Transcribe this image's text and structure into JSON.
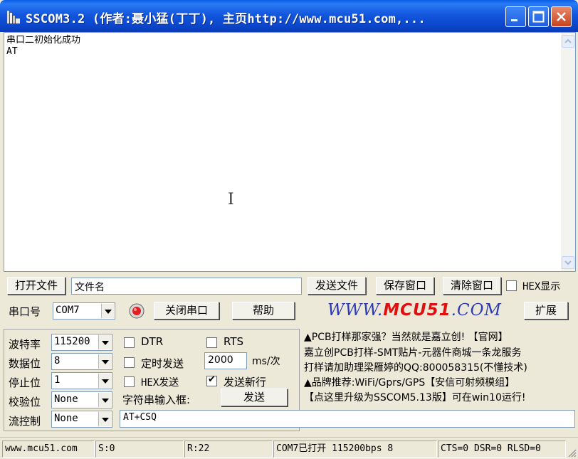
{
  "window": {
    "title": "SSCOM3.2 (作者:聂小猛(丁丁), 主页http://www.mcu51.com,..."
  },
  "receive": {
    "lines": "串口二初始化成功\nAT"
  },
  "file_row": {
    "open_file_label": "打开文件",
    "file_name_value": "文件名",
    "send_file_label": "发送文件",
    "save_window_label": "保存窗口",
    "clear_window_label": "清除窗口",
    "hex_display_label": "HEX显示"
  },
  "port_row": {
    "port_label": "串口号",
    "port_value": "COM7",
    "close_port_label": "关闭串口",
    "help_label": "帮助",
    "brand_prefix": "WWW.",
    "brand_mid": "MCU51",
    "brand_suffix": ".COM",
    "expand_label": "扩展"
  },
  "settings": {
    "baud_label": "波特率",
    "baud_value": "115200",
    "databits_label": "数据位",
    "databits_value": "8",
    "stopbits_label": "停止位",
    "stopbits_value": "1",
    "parity_label": "校验位",
    "parity_value": "None",
    "flow_label": "流控制",
    "flow_value": "None"
  },
  "options": {
    "dtr_label": "DTR",
    "rts_label": "RTS",
    "timed_send_label": "定时发送",
    "interval_value": "2000",
    "interval_unit": "ms/次",
    "hex_send_label": "HEX发送",
    "send_newline_label": "发送新行",
    "input_box_label": "字符串输入框:",
    "send_label": "发送",
    "send_input_value": "AT+CSQ"
  },
  "ads": [
    "▲PCB打样那家强？当然就是嘉立创! 【官网】",
    "嘉立创PCB打样-SMT贴片-元器件商城一条龙服务",
    "打样请加助理梁雁婷的QQ:800058315(不懂技术)",
    "▲品牌推荐:WiFi/Gprs/GPS【安信可射频模组】",
    "【点这里升级为SSCOM5.13版】可在win10运行!"
  ],
  "status": {
    "site": "www.mcu51.com",
    "sent": "S:0",
    "received": "R:22",
    "port_state": "COM7已打开  115200bps  8",
    "lines": "CTS=0 DSR=0 RLSD=0"
  }
}
